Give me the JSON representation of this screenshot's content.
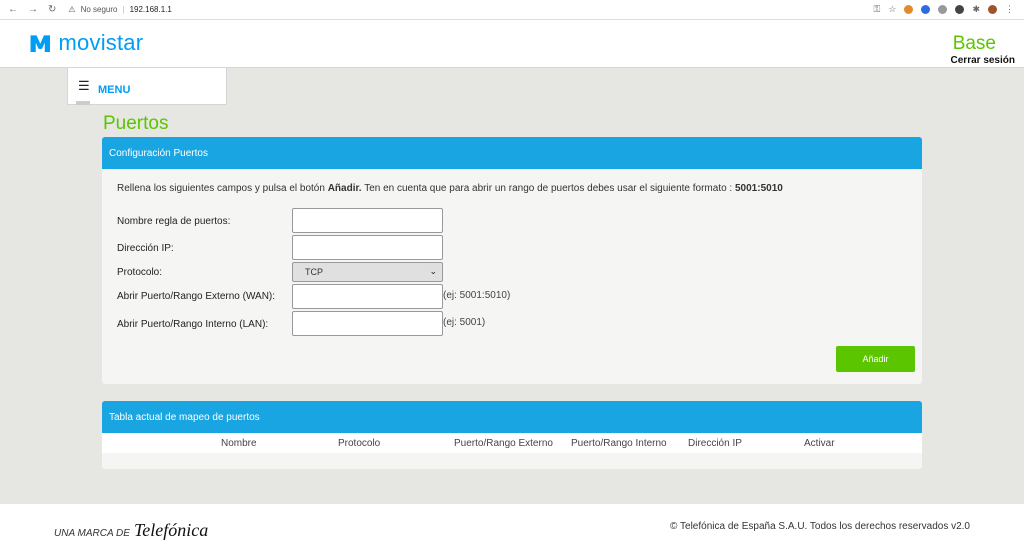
{
  "browser": {
    "security": "No seguro",
    "address": "192.168.1.1"
  },
  "header": {
    "brand": "movistar",
    "profile": "Base",
    "logout": "Cerrar sesión"
  },
  "menu": {
    "label": "MENU"
  },
  "page": {
    "title": "Puertos"
  },
  "config_panel": {
    "heading": "Configuración Puertos",
    "intro_pre": "Rellena los siguientes campos y pulsa el botón ",
    "intro_bold": "Añadir.",
    "intro_mid": " Ten en cuenta que para abrir un rango de puertos debes usar el siguiente formato : ",
    "intro_format": "5001:5010",
    "fields": {
      "rule_name_label": "Nombre regla de puertos:",
      "ip_label": "Dirección IP:",
      "protocol_label": "Protocolo:",
      "protocol_value": "TCP",
      "wan_label": "Abrir Puerto/Rango Externo (WAN):",
      "wan_hint": "(ej: 5001:5010)",
      "lan_label": "Abrir Puerto/Rango Interno (LAN):",
      "lan_hint": "(ej: 5001)"
    },
    "add_button": "Añadir"
  },
  "table_panel": {
    "heading": "Tabla actual de mapeo de puertos",
    "columns": [
      "Nombre",
      "Protocolo",
      "Puerto/Rango Externo",
      "Puerto/Rango Interno",
      "Dirección IP",
      "Activar"
    ]
  },
  "footer": {
    "brand_prefix": "UNA MARCA DE",
    "brand_name": "Telefónica",
    "copyright": "© Telefónica de España S.A.U. Todos los derechos reservados v2.0"
  },
  "colors": {
    "accent_blue": "#019df4",
    "panel_header": "#19a5e1",
    "green": "#5bc500"
  }
}
